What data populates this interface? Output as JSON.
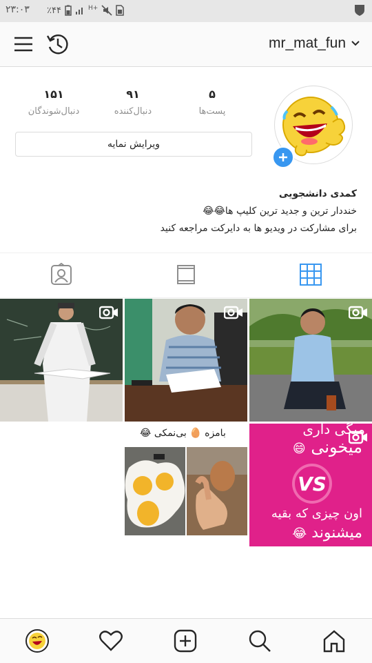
{
  "status": {
    "time": "۲۳:۰۳",
    "battery": "٪۴۴",
    "network": "H+"
  },
  "header": {
    "username": "mr_mat_fun",
    "menu_icon": "hamburger-menu-icon",
    "history_icon": "history-clock-icon"
  },
  "profile": {
    "stats": [
      {
        "label": "پست‌ها",
        "value": "۵"
      },
      {
        "label": "دنبال‌کننده",
        "value": "۹۱"
      },
      {
        "label": "دنبال‌شوندگان",
        "value": "۱۵۱"
      }
    ],
    "edit_label": "ویرایش نمایه",
    "bio_name": "کمدی دانشجویی",
    "bio_line1": "خنددار ترین و جدید ترین کلیپ ها😂😂",
    "bio_line2": "برای مشارکت در ویدیو ها به دایرکت مراجعه کنید"
  },
  "tabs": [
    "grid-icon",
    "list-icon",
    "tagged-person-icon"
  ],
  "posts": {
    "p5_text1": "بامزه",
    "p5_text2": "بی‌نمکی",
    "p6_line1": "میگی داری",
    "p6_line2": "میخونی",
    "p6_vs": "VS",
    "p6_line3": "اون چیزی که بقیه",
    "p6_line4": "میشنوند"
  },
  "colors": {
    "accent": "#3897f0",
    "magenta": "#e0218a",
    "grid_blue": "#3897f0"
  },
  "nav": [
    "profile-avatar",
    "heart-icon",
    "add-post-icon",
    "search-icon",
    "home-icon"
  ]
}
